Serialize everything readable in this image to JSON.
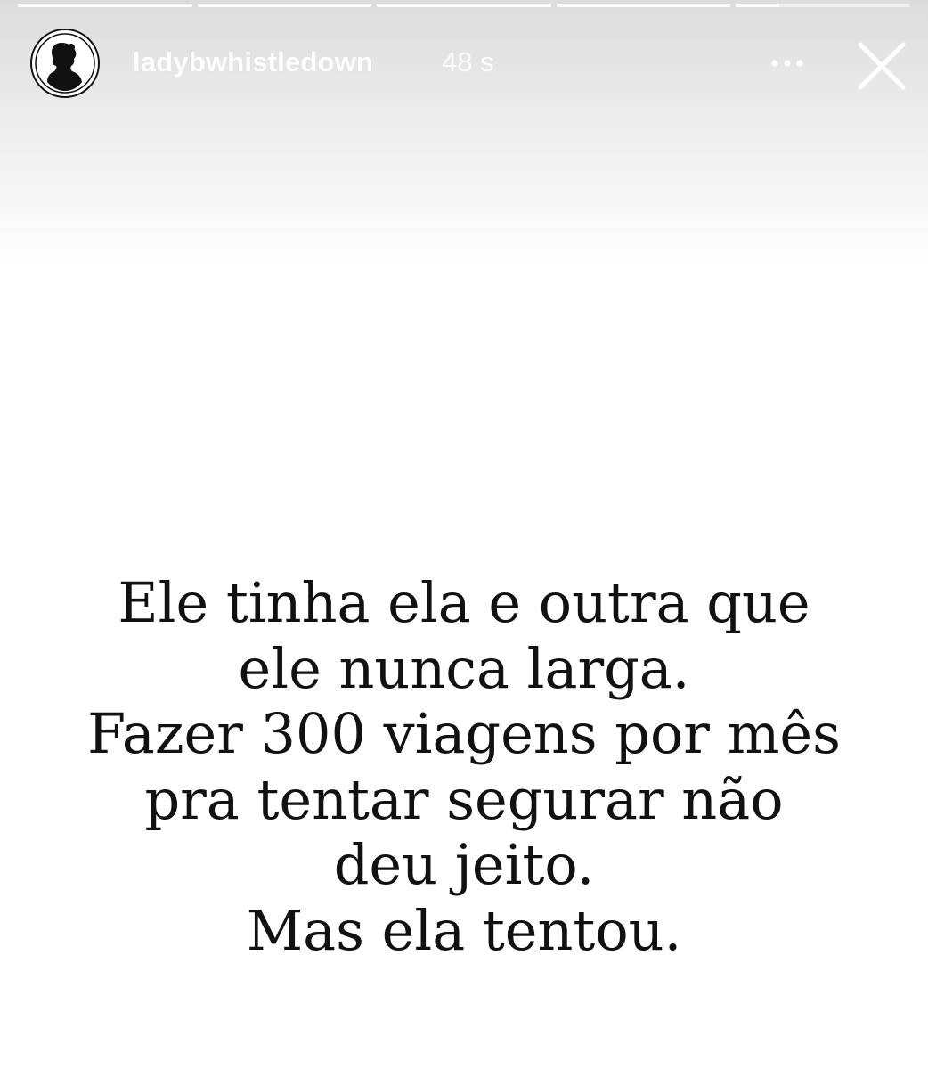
{
  "story": {
    "progress": [
      1,
      1,
      1,
      1,
      0.25
    ],
    "username": "ladybwhistledown",
    "time": "48 s",
    "text_lines": [
      "Ele tinha ela e outra que",
      "ele nunca larga.",
      "Fazer 300 viagens por mês",
      "pra tentar segurar não",
      "deu jeito.",
      "Mas ela tentou."
    ]
  },
  "icons": {
    "avatar": "silhouette-portrait-icon",
    "more": "more-options-icon",
    "close": "close-icon"
  },
  "colors": {
    "background": "#ffffff",
    "text": "#111111",
    "header_text": "#ffffff"
  }
}
